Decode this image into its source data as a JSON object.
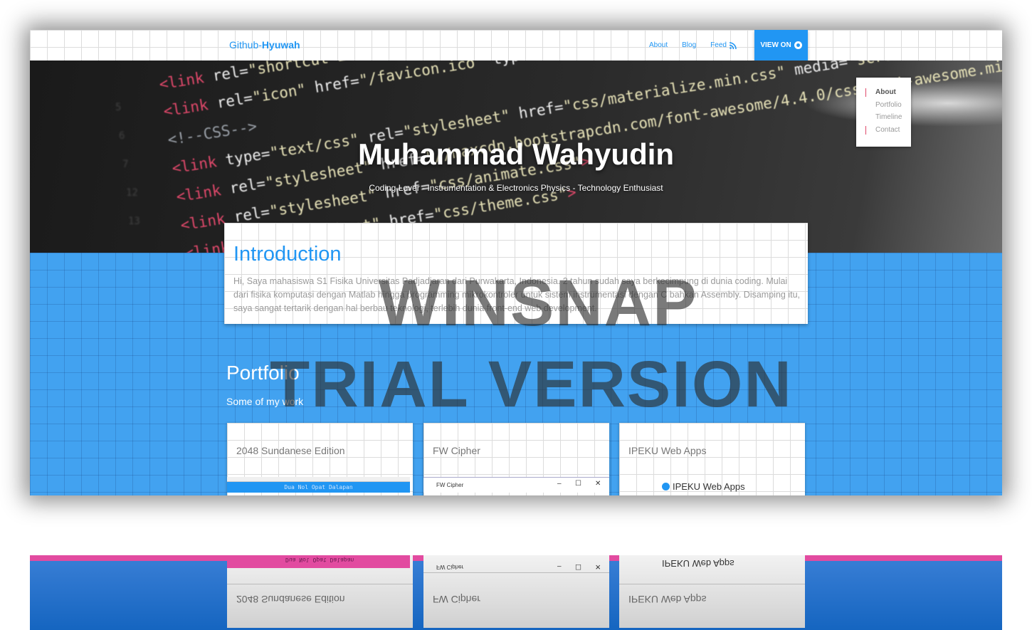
{
  "navbar": {
    "brand_prefix": "Github-",
    "brand_name": "Hyuwah",
    "links": [
      "About",
      "Blog",
      "Feed"
    ],
    "view_on_label": "VIEW ON"
  },
  "hero": {
    "title": "Muhammad Wahyudin",
    "subtitle": "Coding Lover - Instrumentation & Electronics Physics - Technology Enthusiast"
  },
  "toc": {
    "items": [
      "About",
      "Portfolio",
      "Timeline",
      "Contact"
    ],
    "active": "About"
  },
  "intro": {
    "title": "Introduction",
    "text": "Hi, Saya mahasiswa S1 Fisika Universitas Padjadjaran dari Purwakarta, Indonesia. 2 tahun sudah saya berkecimpung di dunia coding. Mulai dari fisika komputasi dengan Matlab hingga programming mikrokontroler untuk sistem instrumentasi dengan C bahkan Assembly. Disamping itu, saya sangat tertarik dengan hal berbau teknologi, terlebih dunia front-end web development."
  },
  "portfolio": {
    "title": "Portfolio",
    "subtitle": "Some of my work",
    "cards": [
      {
        "title": "2048 Sundanese Edition",
        "preview_text": "Dua Nol Opat Dalapan"
      },
      {
        "title": "FW Cipher",
        "preview_text": "FW Cipher"
      },
      {
        "title": "IPEKU Web Apps",
        "preview_text": "IPEKU Web Apps"
      }
    ]
  },
  "watermark": {
    "line1": "WINSNAP",
    "line2": "TRIAL VERSION"
  },
  "colors": {
    "accent": "#2196f3",
    "background_blue": "#42a2f0",
    "toc_marker": "#e0486a"
  }
}
